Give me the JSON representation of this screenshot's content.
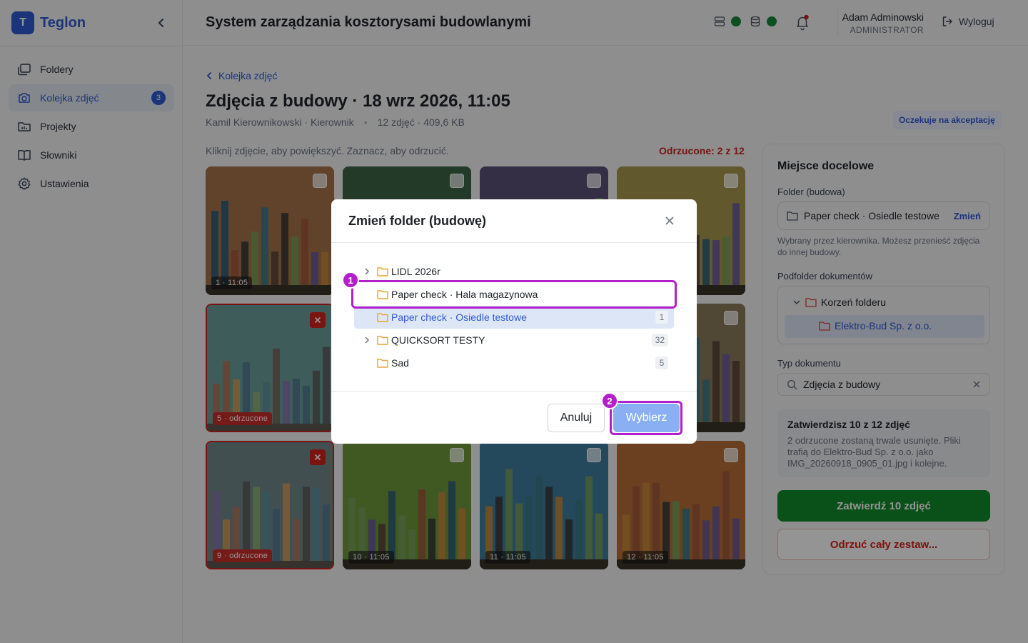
{
  "brand": {
    "logo_letter": "T",
    "name": "Teglon"
  },
  "nav": [
    {
      "label": "Foldery",
      "icon": "folders-icon"
    },
    {
      "label": "Kolejka zdjęć",
      "icon": "camera-icon",
      "badge": "3",
      "active": true
    },
    {
      "label": "Projekty",
      "icon": "chart-folder-icon"
    },
    {
      "label": "Słowniki",
      "icon": "book-icon"
    },
    {
      "label": "Ustawienia",
      "icon": "gear-icon"
    }
  ],
  "header": {
    "title": "System zarządzania kosztorysami budowlanymi",
    "user_name": "Adam Adminowski",
    "user_role": "ADMINISTRATOR",
    "logout_label": "Wyloguj"
  },
  "page": {
    "back_label": "Kolejka zdjęć",
    "title": "Zdjęcia z budowy · 18 wrz 2026, 11:05",
    "author": "Kamil Kierownikowski · Kierownik",
    "stats": "12 zdjęć · 409,6 KB",
    "status": "Oczekuje na akceptację",
    "hint": "Kliknij zdjęcie, aby powiększyć. Zaznacz, aby odrzucić.",
    "rejected_count": "Odrzucone: 2 z 12"
  },
  "photos": [
    {
      "caption": "1 · 11:05",
      "bg": "#a8744a",
      "rejected": false
    },
    {
      "caption": "",
      "bg": "#3f6448",
      "rejected": false
    },
    {
      "caption": "",
      "bg": "#5a5278",
      "rejected": false
    },
    {
      "caption": "",
      "bg": "#a99850",
      "rejected": false
    },
    {
      "caption": "5 · odrzucone",
      "bg": "#4a8a86",
      "rejected": true
    },
    {
      "caption": "",
      "bg": "#3f6448",
      "rejected": false
    },
    {
      "caption": "",
      "bg": "#5a6a7c",
      "rejected": false
    },
    {
      "caption": "",
      "bg": "#8a7a5a",
      "rejected": false
    },
    {
      "caption": "9 · odrzucone",
      "bg": "#536f72",
      "rejected": true
    },
    {
      "caption": "10 · 11:05",
      "bg": "#6e9a3c",
      "rejected": false
    },
    {
      "caption": "11 · 11:05",
      "bg": "#3f7ea0",
      "rejected": false
    },
    {
      "caption": "12 · 11:05",
      "bg": "#b86e38",
      "rejected": false
    }
  ],
  "panel": {
    "title": "Miejsce docelowe",
    "folder_label": "Folder (budowa)",
    "folder_value": "Paper check · Osiedle testowe",
    "change_label": "Zmień",
    "folder_note": "Wybrany przez kierownika. Możesz przenieść zdjęcia do innej budowy.",
    "subfolder_label": "Podfolder dokumentów",
    "tree_root": "Korzeń folderu",
    "tree_child": "Elektro-Bud Sp. z o.o.",
    "doc_type_label": "Typ dokumentu",
    "doc_type_value": "Zdjęcia z budowy",
    "summary_title": "Zatwierdzisz 10 z 12 zdjęć",
    "summary_text": "2 odrzucone zostaną trwale usunięte. Pliki trafią do Elektro-Bud Sp. z o.o. jako IMG_20260918_0905_01.jpg i kolejne.",
    "approve_label": "Zatwierdź 10 zdjęć",
    "reject_label": "Odrzuć cały zestaw..."
  },
  "modal": {
    "title": "Zmień folder (budowę)",
    "rows": [
      {
        "label": "LIDL 2026r",
        "count": "",
        "expandable": true,
        "selected": false
      },
      {
        "label": "Paper check · Hala magazynowa",
        "count": "",
        "expandable": false,
        "selected": false
      },
      {
        "label": "Paper check · Osiedle testowe",
        "count": "1",
        "expandable": false,
        "selected": true
      },
      {
        "label": "QUICKSORT TESTY",
        "count": "32",
        "expandable": true,
        "selected": false
      },
      {
        "label": "Sad",
        "count": "5",
        "expandable": false,
        "selected": false
      }
    ],
    "cancel_label": "Anuluj",
    "choose_label": "Wybierz"
  },
  "annotations": [
    {
      "number": "1"
    },
    {
      "number": "2"
    }
  ],
  "colors": {
    "accent": "#2f5bd3",
    "danger": "#d0231c",
    "success": "#108a2c",
    "annotation": "#b31fc9"
  }
}
